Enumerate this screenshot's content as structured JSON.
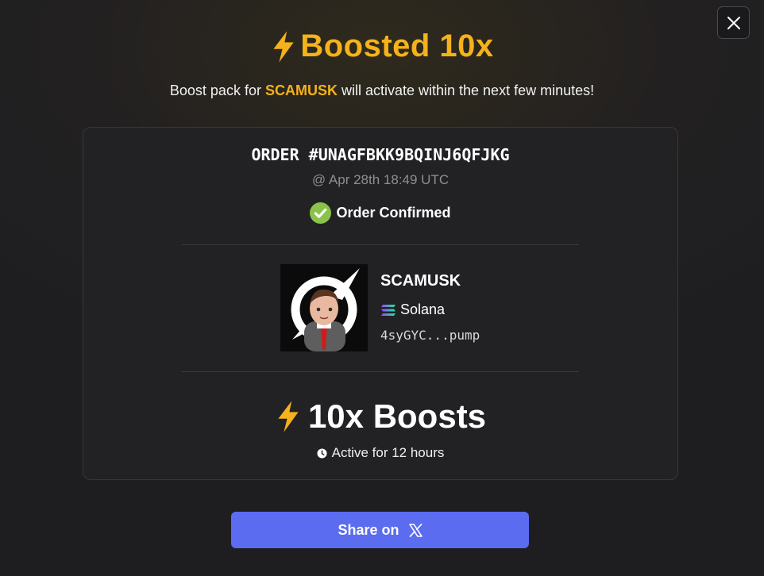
{
  "modal": {
    "close_icon": "close-icon",
    "title": "Boosted 10x",
    "subtitle_prefix": "Boost pack for ",
    "subtitle_token": "SCAMUSK",
    "subtitle_suffix": " will activate within the next few minutes!"
  },
  "order": {
    "id": "ORDER #UNAGFBKK9BQINJ6QFJKG",
    "time": "@ Apr 28th 18:49 UTC",
    "status": "Order Confirmed"
  },
  "token": {
    "name": "SCAMUSK",
    "chain": "Solana",
    "address": "4syGYC...pump"
  },
  "boost": {
    "label": "10x Boosts",
    "duration": "Active for 12 hours"
  },
  "share": {
    "label": "Share on"
  },
  "colors": {
    "accent": "#f5b21b",
    "confirm": "#8bc34a",
    "button": "#5b6cf0"
  }
}
